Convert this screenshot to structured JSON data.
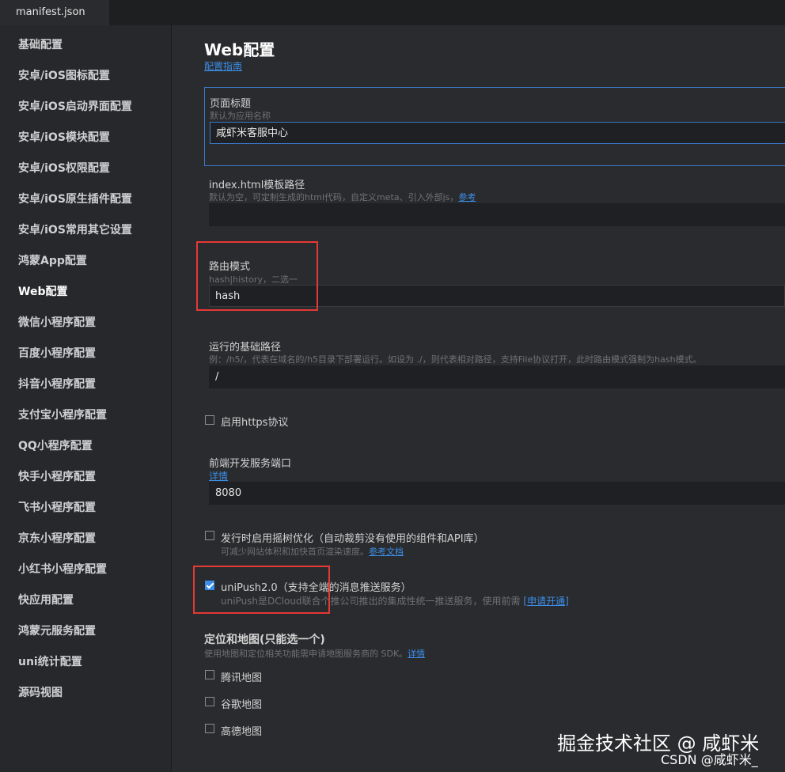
{
  "tab": {
    "filename": "manifest.json"
  },
  "sidebar": {
    "items": [
      {
        "label": "基础配置"
      },
      {
        "label": "安卓/iOS图标配置"
      },
      {
        "label": "安卓/iOS启动界面配置"
      },
      {
        "label": "安卓/iOS模块配置"
      },
      {
        "label": "安卓/iOS权限配置"
      },
      {
        "label": "安卓/iOS原生插件配置"
      },
      {
        "label": "安卓/iOS常用其它设置"
      },
      {
        "label": "鸿蒙App配置"
      },
      {
        "label": "Web配置",
        "active": true
      },
      {
        "label": "微信小程序配置"
      },
      {
        "label": "百度小程序配置"
      },
      {
        "label": "抖音小程序配置"
      },
      {
        "label": "支付宝小程序配置"
      },
      {
        "label": "QQ小程序配置"
      },
      {
        "label": "快手小程序配置"
      },
      {
        "label": "飞书小程序配置"
      },
      {
        "label": "京东小程序配置"
      },
      {
        "label": "小红书小程序配置"
      },
      {
        "label": "快应用配置"
      },
      {
        "label": "鸿蒙元服务配置"
      },
      {
        "label": "uni统计配置"
      },
      {
        "label": "源码视图"
      }
    ]
  },
  "main": {
    "title": "Web配置",
    "guide_link": "配置指南",
    "page_title": {
      "label": "页面标题",
      "hint": "默认为应用名称",
      "value": "咸虾米客服中心"
    },
    "template_path": {
      "label": "index.html模板路径",
      "hint": "默认为空，可定制生成的html代码，自定义meta、引入外部js，",
      "link": "参考",
      "value": ""
    },
    "router_mode": {
      "label": "路由模式",
      "hint": "hash|history，二选一",
      "value": "hash"
    },
    "base_path": {
      "label": "运行的基础路径",
      "hint": "例：/h5/，代表在域名的/h5目录下部署运行。如设为 ./，则代表相对路径，支持File协议打开，此时路由模式强制为hash模式。",
      "value": "/"
    },
    "https": {
      "label": "启用https协议",
      "checked": false
    },
    "dev_port": {
      "label": "前端开发服务端口",
      "link": "详情",
      "value": "8080"
    },
    "tree_shaking": {
      "label": "发行时启用摇树优化（自动裁剪没有使用的组件和API库）",
      "hint": "可减少网站体积和加快首页渲染速度。",
      "link": "参考文档",
      "checked": false
    },
    "unipush": {
      "label": "uniPush2.0（支持全端的消息推送服务）",
      "hint": "uniPush是DCloud联合个推公司推出的集成性统一推送服务，使用前需",
      "link": "[申请开通]",
      "checked": true
    },
    "maps": {
      "title": "定位和地图(只能选一个)",
      "hint": "使用地图和定位相关功能需申请地图服务商的 SDK。",
      "link": "详情",
      "options": [
        {
          "label": "腾讯地图",
          "checked": false
        },
        {
          "label": "谷歌地图",
          "checked": false
        },
        {
          "label": "高德地图",
          "checked": false
        }
      ]
    }
  },
  "watermark": {
    "line1": "掘金技术社区 @ 咸虾米",
    "line2": "CSDN @咸虾米_"
  },
  "colors": {
    "accent": "#3b8ee8",
    "highlight_box": "#e53935",
    "background": "#2a2b2e",
    "sidebar": "#27282b"
  }
}
